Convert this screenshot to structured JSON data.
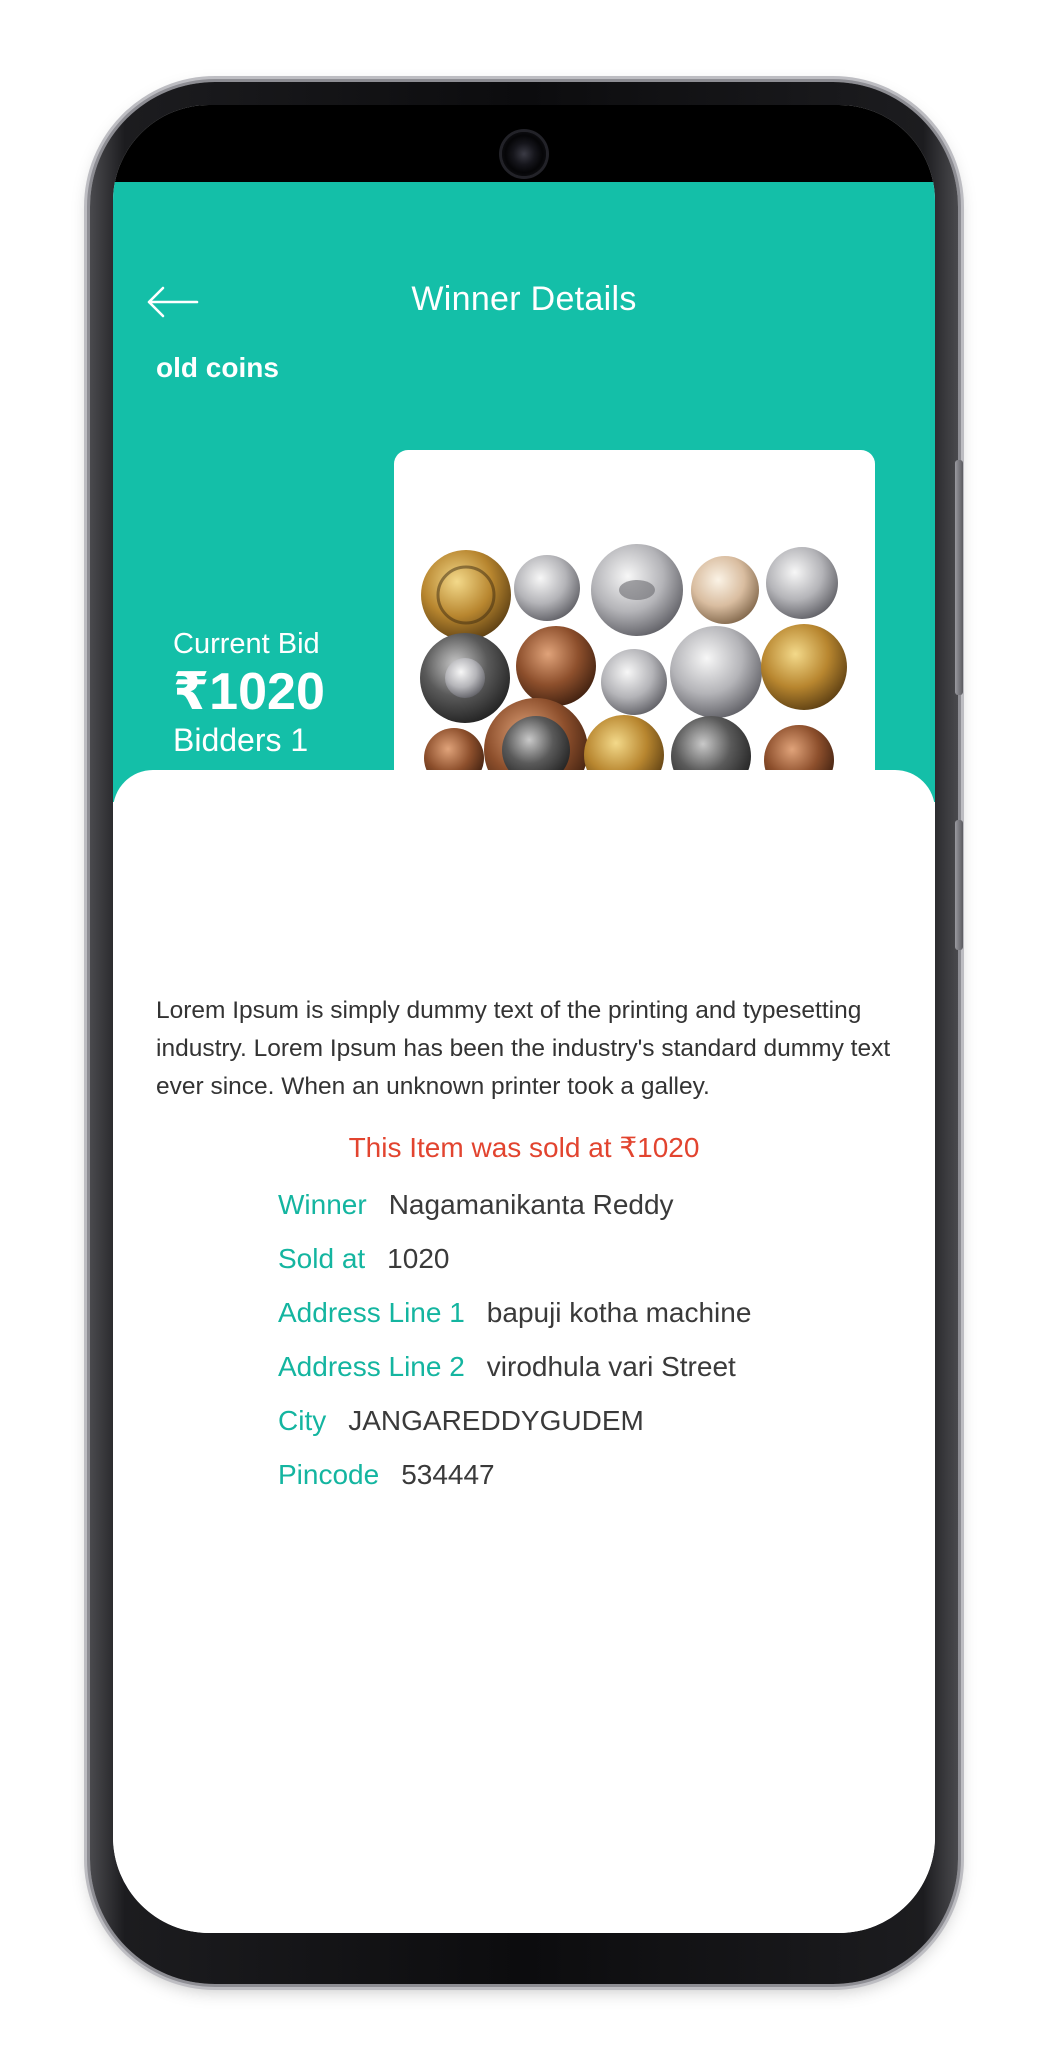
{
  "header": {
    "title": "Winner Details",
    "item_name": "old coins"
  },
  "bid": {
    "label": "Current Bid",
    "value": "₹1020",
    "bidders": "Bidders 1"
  },
  "description": "Lorem Ipsum is simply dummy text of the printing and typesetting industry. Lorem Ipsum has been the industry's standard dummy text ever since. When an unknown printer took a galley.",
  "sold_message": "This Item was sold at ₹1020",
  "details": [
    {
      "label": "Winner",
      "value": "Nagamanikanta Reddy"
    },
    {
      "label": "Sold at",
      "value": "1020"
    },
    {
      "label": "Address Line 1",
      "value": "bapuji kotha machine"
    },
    {
      "label": "Address Line 2",
      "value": "virodhula vari Street"
    },
    {
      "label": "City",
      "value": "JANGAREDDYGUDEM"
    },
    {
      "label": "Pincode",
      "value": "534447"
    }
  ],
  "colors": {
    "primary": "#14bfa8",
    "label_teal": "#14b5a0",
    "sold_red": "#e2442f"
  },
  "icons": {
    "back": "arrow-left-icon",
    "camera": "front-camera"
  }
}
